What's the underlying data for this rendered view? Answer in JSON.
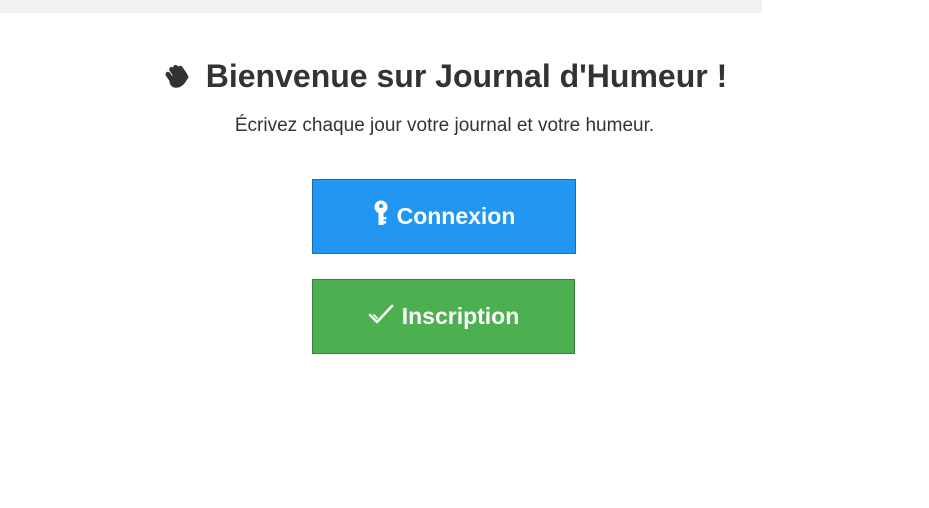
{
  "header": {
    "title": "Bienvenue sur Journal d'Humeur !",
    "title_icon": "waving-hand-icon",
    "subtitle": "Écrivez chaque jour votre journal et votre humeur."
  },
  "actions": {
    "login_label": "Connexion",
    "login_icon": "key-icon",
    "login_color": "#2196f3",
    "register_label": "Inscription",
    "register_icon": "check-icon",
    "register_color": "#4caf50"
  }
}
